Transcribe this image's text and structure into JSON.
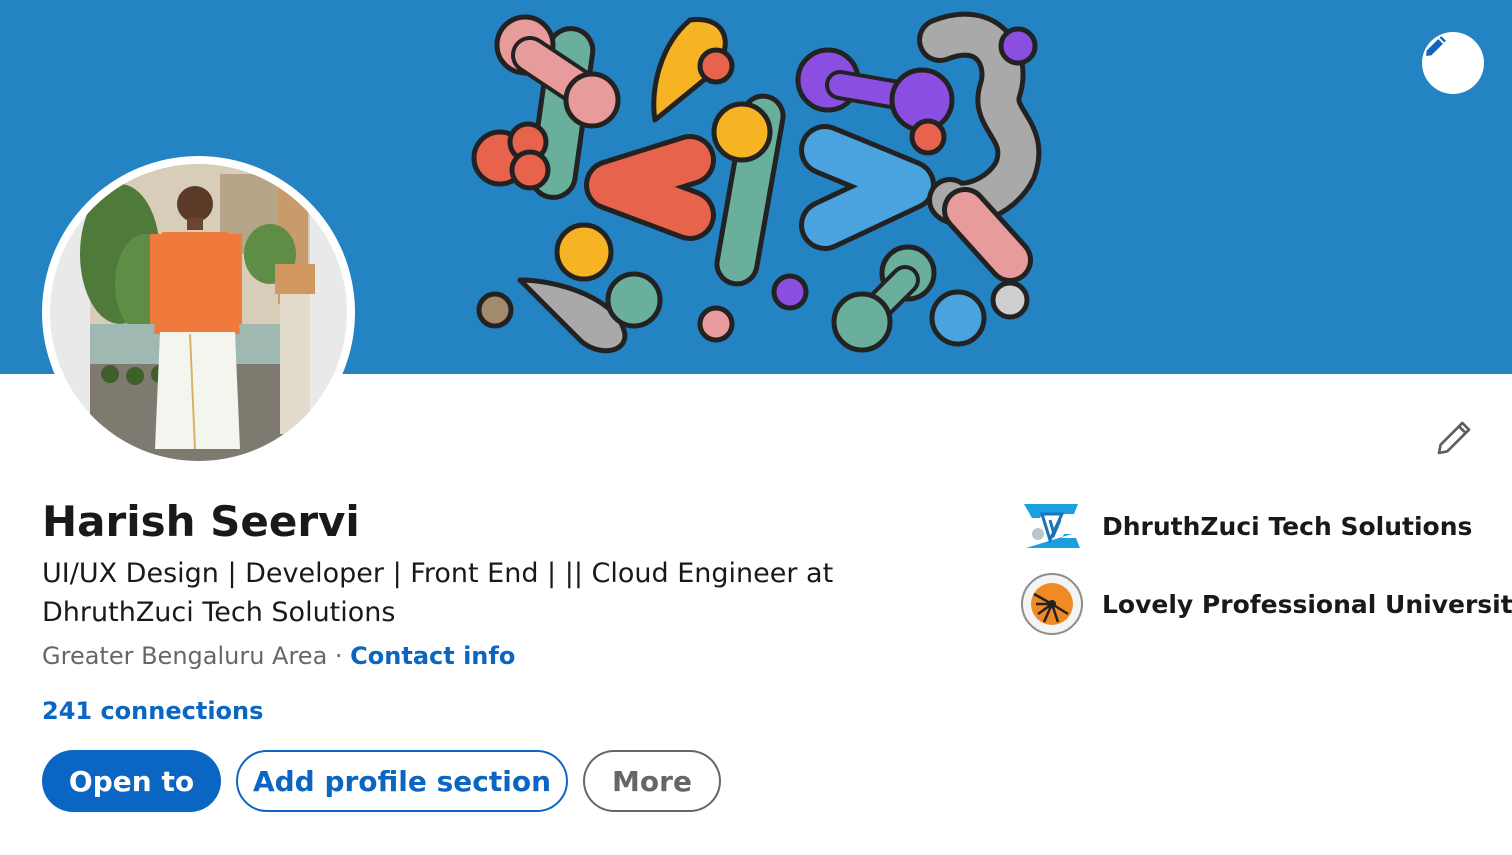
{
  "profile": {
    "name": "Harish Seervi",
    "headline": "UI/UX Design | Developer | Front End | || Cloud Engineer at DhruthZuci Tech Solutions",
    "location": "Greater Bengaluru Area",
    "separator": " · ",
    "contact_info_label": "Contact info",
    "connections_label": "241 connections"
  },
  "actions": {
    "open_to_label": "Open to",
    "add_section_label": "Add profile section",
    "more_label": "More"
  },
  "organizations": [
    {
      "name": "DhruthZuci Tech Solutions",
      "logo_icon": "dhruthzuci-logo-icon"
    },
    {
      "name": "Lovely Professional University",
      "logo_icon": "lpu-logo-icon"
    }
  ],
  "icons": {
    "banner_edit": "pencil-icon",
    "intro_edit": "pencil-outline-icon"
  },
  "colors": {
    "banner_bg": "#2383c3",
    "primary": "#0a66c2",
    "text_primary": "#191919",
    "text_secondary": "#666666"
  }
}
